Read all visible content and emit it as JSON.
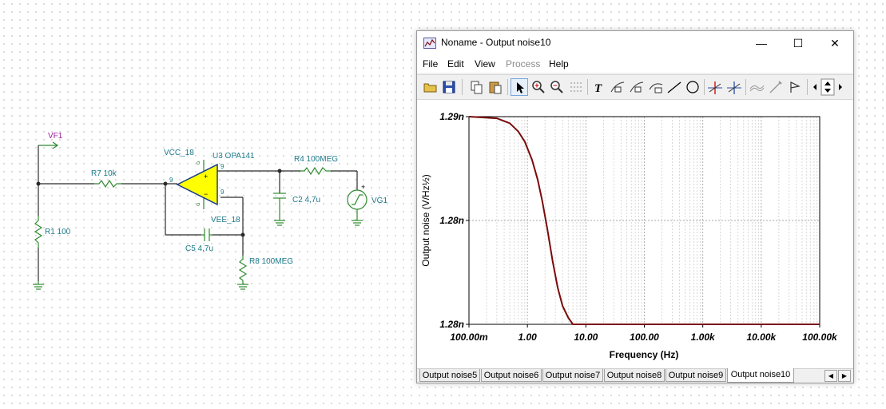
{
  "schematic": {
    "labels": {
      "vf1": "VF1",
      "r7": "R7 10k",
      "r1": "R1 100",
      "vcc": "VCC_18",
      "u3": "U3 OPA141",
      "vee": "VEE_18",
      "c5": "C5 4,7u",
      "r8": "R8 100MEG",
      "r4": "R4 100MEG",
      "c2": "C2 4,7u",
      "vg1": "VG1",
      "pin_a": "9",
      "pin_b": "9",
      "pin_c": "9",
      "plus": "+",
      "minus": "−",
      "sigma1": "σ",
      "sigma2": "σ"
    }
  },
  "window": {
    "title": "Noname - Output noise10",
    "controls": {
      "minimize": "—",
      "maximize": "☐",
      "close": "✕"
    },
    "menu": [
      {
        "label": "File",
        "disabled": false
      },
      {
        "label": "Edit",
        "disabled": false
      },
      {
        "label": "View",
        "disabled": false
      },
      {
        "label": "Process",
        "disabled": true
      },
      {
        "label": "Help",
        "disabled": false
      }
    ],
    "tabs": [
      {
        "label": "Output noise5",
        "active": false
      },
      {
        "label": "Output noise6",
        "active": false
      },
      {
        "label": "Output noise7",
        "active": false
      },
      {
        "label": "Output noise8",
        "active": false
      },
      {
        "label": "Output noise9",
        "active": false
      },
      {
        "label": "Output noise10",
        "active": true
      }
    ],
    "tab_nav": {
      "left": "◀",
      "right": "▶"
    }
  },
  "colors": {
    "curve": "#7a0a0a",
    "schematic_text": "#1d7a8a",
    "opamp_fill": "#ffff00",
    "source_text": "#9b1e9b"
  },
  "chart_data": {
    "type": "line",
    "xlabel": "Frequency (Hz)",
    "ylabel": "Output noise (V/Hz½)",
    "x_scale": "log",
    "xlim": [
      0.1,
      100000
    ],
    "x_ticks": [
      {
        "value": 0.1,
        "label": "100.00m"
      },
      {
        "value": 1,
        "label": "1.00"
      },
      {
        "value": 10,
        "label": "10.00"
      },
      {
        "value": 100,
        "label": "100.00"
      },
      {
        "value": 1000,
        "label": "1.00k"
      },
      {
        "value": 10000,
        "label": "10.00k"
      },
      {
        "value": 100000,
        "label": "100.00k"
      }
    ],
    "ylim": [
      1.2775,
      1.29
    ],
    "y_ticks": [
      {
        "value": 1.29,
        "label": "1.29n"
      },
      {
        "value": 1.28375,
        "label": "1.28n"
      },
      {
        "value": 1.2775,
        "label": "1.28n"
      }
    ],
    "grid": true,
    "series": [
      {
        "x": [
          0.1,
          0.3,
          0.5,
          0.7,
          0.9,
          1.2,
          1.5,
          1.8,
          2.2,
          2.7,
          3.3,
          4,
          5,
          6,
          7,
          8,
          10,
          12,
          15,
          20,
          30,
          50,
          100,
          1000,
          10000,
          100000
        ],
        "y": [
          1.29,
          1.2899,
          1.2896,
          1.2891,
          1.2885,
          1.2874,
          1.2862,
          1.2849,
          1.2832,
          1.2813,
          1.2797,
          1.2786,
          1.2779,
          1.2775,
          1.2771,
          1.2768,
          1.2763,
          1.2761,
          1.27595,
          1.27586,
          1.2758,
          1.27575,
          1.2775,
          1.2775,
          1.2775,
          1.2775
        ]
      }
    ]
  }
}
